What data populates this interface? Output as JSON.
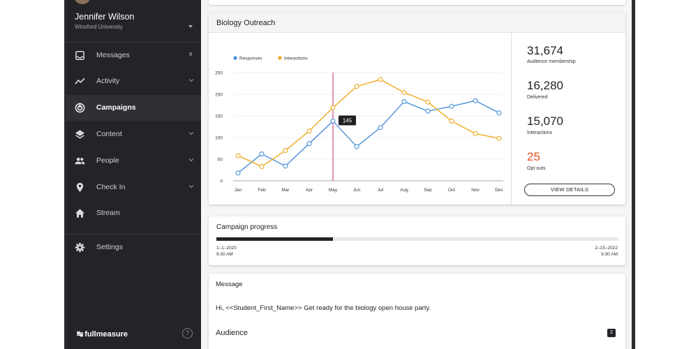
{
  "user": {
    "name": "Jennifer Wilson",
    "org": "Winsford University"
  },
  "nav": {
    "messages": {
      "label": "Messages",
      "badge": "9"
    },
    "activity": {
      "label": "Activity"
    },
    "campaigns": {
      "label": "Campaigns"
    },
    "content": {
      "label": "Content"
    },
    "people": {
      "label": "People"
    },
    "checkin": {
      "label": "Check In"
    },
    "stream": {
      "label": "Stream"
    },
    "settings": {
      "label": "Settings"
    }
  },
  "brand": {
    "name": "fullmeasure",
    "mark": "↹"
  },
  "help": {
    "label": "?"
  },
  "outreach": {
    "title": "Biology Outreach",
    "stats": [
      {
        "value": "31,674",
        "label": "Audience membership"
      },
      {
        "value": "16,280",
        "label": "Delivered"
      },
      {
        "value": "15,070",
        "label": "Interactions"
      },
      {
        "value": "25",
        "label": "Opt outs"
      }
    ],
    "view_details": "VIEW DETAILS"
  },
  "chart_data": {
    "type": "line",
    "categories": [
      "Jan",
      "Feb",
      "Mar",
      "Apr",
      "May",
      "Jun",
      "Jul",
      "Aug",
      "Sep",
      "Oct",
      "Nov",
      "Dec"
    ],
    "series": [
      {
        "name": "Responses",
        "color": "#4a90d9",
        "values": [
          18,
          62,
          34,
          86,
          138,
          79,
          123,
          183,
          161,
          172,
          185,
          157
        ]
      },
      {
        "name": "Interactions",
        "color": "#f0a921",
        "values": [
          58,
          33,
          70,
          115,
          169,
          218,
          234,
          204,
          182,
          138,
          109,
          98
        ]
      }
    ],
    "yticks": [
      "0",
      "50",
      "100",
      "150",
      "200",
      "250"
    ],
    "ylim": [
      0,
      250
    ],
    "grid": true,
    "legend": "top-left",
    "tooltip": {
      "category": "May",
      "value": "145"
    }
  },
  "progress": {
    "title": "Campaign progress",
    "fraction": 0.29,
    "start_date": "1–1–2020",
    "start_time": "9:30 AM",
    "end_date": "2–15–2022",
    "end_time": "9:30 AM"
  },
  "message": {
    "title": "Message",
    "body": "Hi, <<Student_First_Name>> Get ready for the biology open house party.",
    "audience_label": "Audience",
    "audience_count": "2"
  },
  "colors": {
    "accent_opt_out": "#e8521e",
    "sidebar": "#222427",
    "tooltip_line": "#c2185b"
  }
}
